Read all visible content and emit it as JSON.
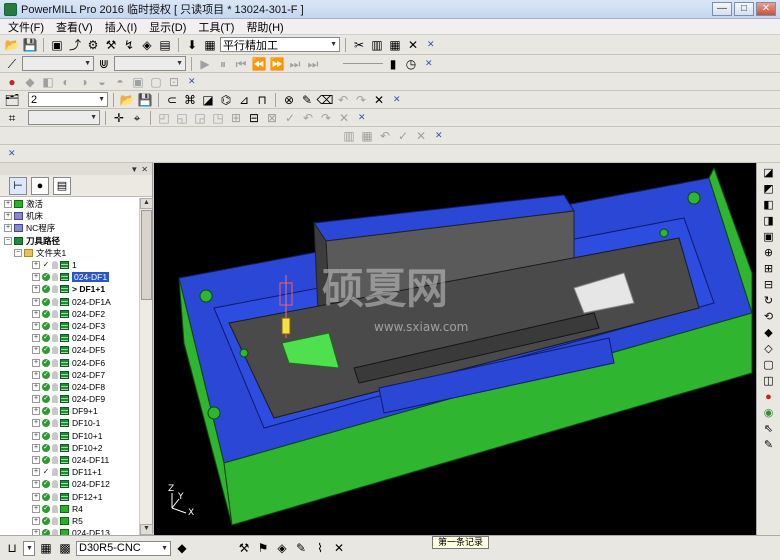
{
  "titlebar": {
    "title": "PowerMILL Pro 2016 临时授权   [ 只读项目 * 13024-301-F ]",
    "minimize": "—",
    "maximize": "□",
    "close": "✕"
  },
  "menu": [
    "文件(F)",
    "查看(V)",
    "插入(I)",
    "显示(D)",
    "工具(T)",
    "帮助(H)"
  ],
  "toolbar1": {
    "strategy_combo": "平行精加工"
  },
  "toolbar3": {
    "workplane_combo": "2"
  },
  "tree": {
    "items": [
      {
        "label": "激活",
        "type": "root"
      },
      {
        "label": "机床",
        "type": "root"
      },
      {
        "label": "NC程序",
        "type": "root"
      },
      {
        "label": "刀具路径",
        "type": "root-bold"
      },
      {
        "label": "文件夹1",
        "type": "folder"
      },
      {
        "label": "1",
        "type": "tp"
      },
      {
        "label": "024-DF1",
        "type": "tp-sel"
      },
      {
        "label": "> DF1+1",
        "type": "tp-bold"
      },
      {
        "label": "024-DF1A",
        "type": "tp"
      },
      {
        "label": "024-DF2",
        "type": "tp"
      },
      {
        "label": "024-DF3",
        "type": "tp"
      },
      {
        "label": "024-DF4",
        "type": "tp"
      },
      {
        "label": "024-DF5",
        "type": "tp"
      },
      {
        "label": "024-DF6",
        "type": "tp"
      },
      {
        "label": "024-DF7",
        "type": "tp"
      },
      {
        "label": "024-DF8",
        "type": "tp"
      },
      {
        "label": "024-DF9",
        "type": "tp"
      },
      {
        "label": "DF9+1",
        "type": "tp"
      },
      {
        "label": "DF10-1",
        "type": "tp"
      },
      {
        "label": "DF10+1",
        "type": "tp"
      },
      {
        "label": "DF10+2",
        "type": "tp"
      },
      {
        "label": "024-DF11",
        "type": "tp"
      },
      {
        "label": "DF11+1",
        "type": "tp"
      },
      {
        "label": "024-DF12",
        "type": "tp"
      },
      {
        "label": "DF12+1",
        "type": "tp"
      },
      {
        "label": "R4",
        "type": "tp"
      },
      {
        "label": "R5",
        "type": "tp"
      },
      {
        "label": "024-DF13",
        "type": "tp"
      }
    ]
  },
  "viewport": {
    "watermark": "硕夏网",
    "watermark_url": "www.sxiaw.com",
    "axis_z": "Z",
    "axis_y": "Y",
    "axis_x": "X"
  },
  "statusbar": {
    "tool_combo": "D30R5-CNC",
    "tooltip": "第一条记录"
  },
  "colors": {
    "mold_blue": "#2a47d6",
    "mold_green": "#2fb52f",
    "cavity_gray": "#4a4a4a",
    "selection": "#2a55c8"
  }
}
